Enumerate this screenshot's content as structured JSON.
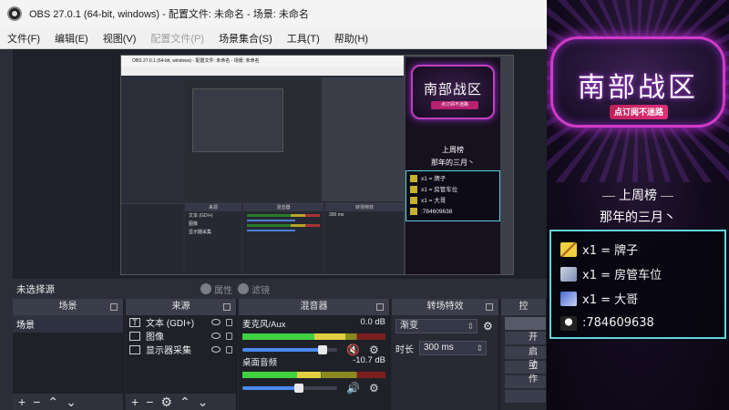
{
  "window": {
    "title": "OBS 27.0.1 (64-bit, windows) - 配置文件: 未命名 - 场景: 未命名"
  },
  "menu": [
    "文件(F)",
    "编辑(E)",
    "视图(V)",
    "配置文件(P)",
    "场景集合(S)",
    "工具(T)",
    "帮助(H)"
  ],
  "status": {
    "no_source": "未选择源",
    "properties": "属性",
    "filters": "滤镜"
  },
  "docks": {
    "scenes": {
      "title": "场景",
      "items": [
        "场景"
      ]
    },
    "sources": {
      "title": "来源",
      "items": [
        {
          "icon": "text-icon",
          "label": "文本 (GDI+)"
        },
        {
          "icon": "image-icon",
          "label": "图像"
        },
        {
          "icon": "monitor-icon",
          "label": "显示器采集"
        }
      ]
    },
    "mixer": {
      "title": "混音器",
      "channels": [
        {
          "name": "麦克风/Aux",
          "db": "0.0 dB",
          "level": 0.72,
          "volume": 0.85,
          "muted": true
        },
        {
          "name": "桌面音频",
          "db": "-10.7 dB",
          "level": 0.55,
          "volume": 0.6,
          "muted": false
        }
      ]
    },
    "transitions": {
      "title": "转场特效",
      "type": "渐变",
      "duration_label": "时长",
      "duration": "300 ms"
    },
    "controls": {
      "title": "控",
      "buttons": [
        "开",
        "启动",
        "工作",
        "",
        ""
      ]
    }
  },
  "nested": {
    "title": "OBS 27.0.1 (64-bit, windows) - 配置文件: 未命名 - 场景: 未命名",
    "src_header": "来源",
    "sources": [
      "文本 (GDI+)",
      "图像",
      "显示器采集"
    ],
    "mixer_header": "混音器",
    "trans_header": "转场特效",
    "duration": "300 ms"
  },
  "overlay": {
    "banner_title": "南部战区",
    "banner_sub": "点订阅不迷路",
    "heading_top": "上周榜",
    "heading_sub": "那年的三月丶",
    "entries": [
      {
        "icon": "pencil-icon",
        "text": "x1 = 牌子"
      },
      {
        "icon": "plane-icon",
        "text": "x1 = 房管车位"
      },
      {
        "icon": "rocket-icon",
        "text": "x1 = 大哥"
      },
      {
        "icon": "qq-icon",
        "text": ":784609638"
      }
    ]
  }
}
